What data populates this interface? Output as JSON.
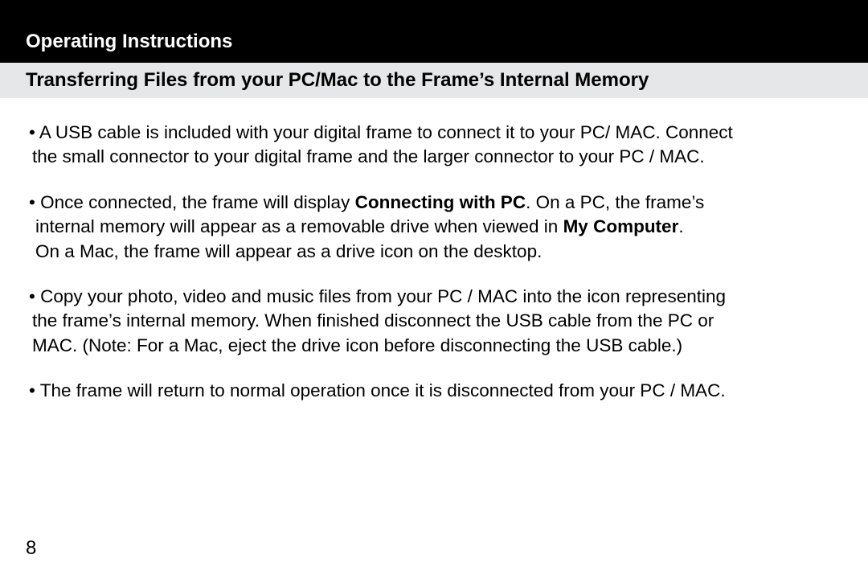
{
  "header": {
    "title": "Operating Instructions"
  },
  "subheader": {
    "title": "Transferring Files from your PC/Mac to the Frame’s Internal Memory"
  },
  "bullets": {
    "b1": {
      "line1": "• A USB cable is included with your digital frame to connect it to your PC/ MAC.  Connect",
      "line2": "the small connector to your digital frame and the larger connector to your PC / MAC."
    },
    "b2": {
      "line1_pre": "• Once connected, the frame will display ",
      "line1_bold": "Connecting with PC",
      "line1_post": ".  On a PC, the frame’s",
      "line2_pre": "internal memory will appear as a removable drive when viewed in ",
      "line2_bold": "My Computer",
      "line2_post": ".",
      "line3": "On a Mac, the frame will appear as a drive icon on the desktop."
    },
    "b3": {
      "line1": "• Copy your photo, video and music files from your PC / MAC into the icon representing",
      "line2": "the frame’s internal memory.  When finished disconnect the USB cable from the PC or",
      "line3": "MAC.  (Note: For a Mac, eject the drive icon before disconnecting the USB cable.)"
    },
    "b4": {
      "line1": "• The frame will return to normal operation once it is disconnected from your PC / MAC."
    }
  },
  "page_number": "8"
}
